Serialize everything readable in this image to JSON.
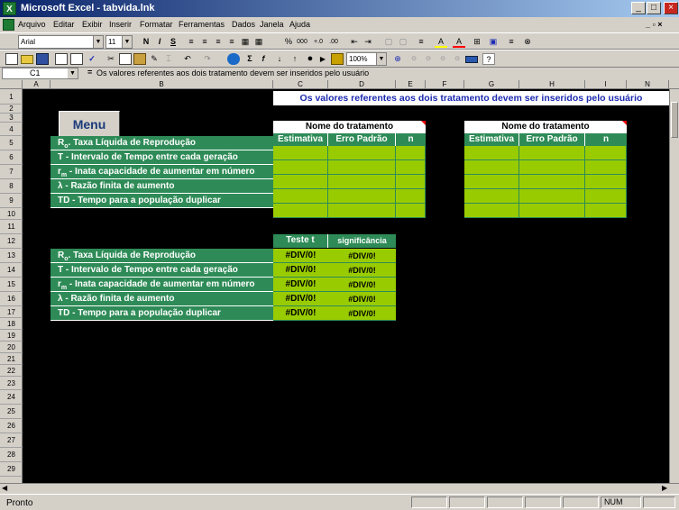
{
  "window": {
    "title": "Microsoft Excel - tabvida.lnk",
    "app_icon": "X",
    "minimize": "_",
    "maximize": "□",
    "close": "×"
  },
  "menubar": {
    "items": [
      "Arquivo",
      "Editar",
      "Exibir",
      "Inserir",
      "Formatar",
      "Ferramentas",
      "Dados",
      "Janela",
      "Ajuda"
    ],
    "mdi_controls": "_ ▫ ×"
  },
  "format_toolbar": {
    "font": "Arial",
    "size": "11",
    "buttons": [
      "N",
      "I",
      "S",
      "≡",
      "≡",
      "≡",
      "≡",
      "▦",
      "▦",
      "%",
      "000",
      "+.0",
      ".00",
      "⇤",
      "⇥",
      "▢",
      "▢",
      "≡",
      "A",
      "A",
      "⊞",
      "▣",
      "≡",
      "⊗"
    ]
  },
  "standard_toolbar": {
    "zoom": "100%"
  },
  "formula_bar": {
    "cell_ref": "C1",
    "equals": "=",
    "content": "Os valores referentes aos dois tratamento devem ser inseridos pelo usuário"
  },
  "sheet": {
    "columns": [
      "A",
      "B",
      "C",
      "D",
      "E",
      "F",
      "G",
      "H",
      "I",
      "N"
    ],
    "rows": [
      "1",
      "2",
      "3",
      "4",
      "5",
      "6",
      "7",
      "8",
      "9",
      "10",
      "11",
      "12",
      "13",
      "14",
      "15",
      "16",
      "17",
      "18",
      "19",
      "20",
      "21",
      "22",
      "23",
      "24",
      "25",
      "26",
      "27",
      "28",
      "29"
    ],
    "note": "Os valores referentes aos dois tratamento devem ser inseridos pelo usuário",
    "menu_button": "Menu",
    "treatment_header": "Nome do tratamento",
    "col_estimativa": "Estimativa",
    "col_erro": "Erro Padrão",
    "col_n": "n",
    "params_sub": [
      "R",
      "T",
      "r",
      "λ",
      "TD"
    ],
    "param_subscripts": [
      "o",
      "",
      "m",
      "",
      ""
    ],
    "param_texts": [
      ". Taxa Líquida de Reprodução",
      "T - Intervalo de Tempo entre cada geração",
      " - Inata capacidade de aumentar em número",
      " - Razão finita de aumento",
      "TD - Tempo para a população duplicar"
    ],
    "test_header": "Teste t",
    "sig_header": "significância",
    "test_values": [
      "#DIV/0!",
      "#DIV/0!",
      "#DIV/0!",
      "#DIV/0!",
      "#DIV/0!"
    ],
    "sig_values": [
      "#DIV/0!",
      "#DIV/0!",
      "#DIV/0!",
      "#DIV/0!",
      "#DIV/0!"
    ]
  },
  "statusbar": {
    "status": "Pronto",
    "num": "NUM"
  }
}
